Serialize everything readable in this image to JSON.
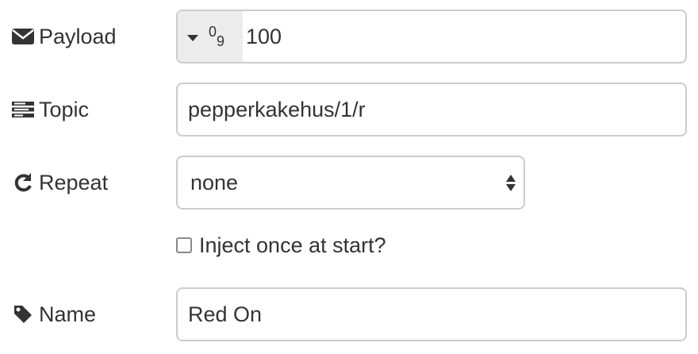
{
  "payload": {
    "label": "Payload",
    "icon": "envelope-icon",
    "type_icon_sup": "0",
    "type_icon_sub": "9",
    "value": "100"
  },
  "topic": {
    "label": "Topic",
    "icon": "topic-list-icon",
    "value": "pepperkakehus/1/r"
  },
  "repeat": {
    "label": "Repeat",
    "icon": "refresh-icon",
    "selected": "none"
  },
  "inject_once": {
    "label": "Inject once at start?",
    "checked": false
  },
  "name": {
    "label": "Name",
    "icon": "tag-icon",
    "value": "Red On"
  }
}
